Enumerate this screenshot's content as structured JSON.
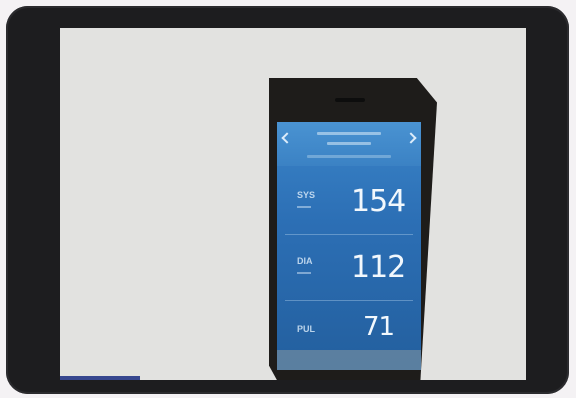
{
  "readings": {
    "systolic": {
      "label": "SYS",
      "value": "154"
    },
    "diastolic": {
      "label": "DIA",
      "value": "112"
    },
    "pulse": {
      "label": "PUL",
      "value": "71"
    }
  },
  "colors": {
    "bezel": "#1d1d1f",
    "screen": "#e2e2e0",
    "app_blue": "#2c6fb5"
  }
}
